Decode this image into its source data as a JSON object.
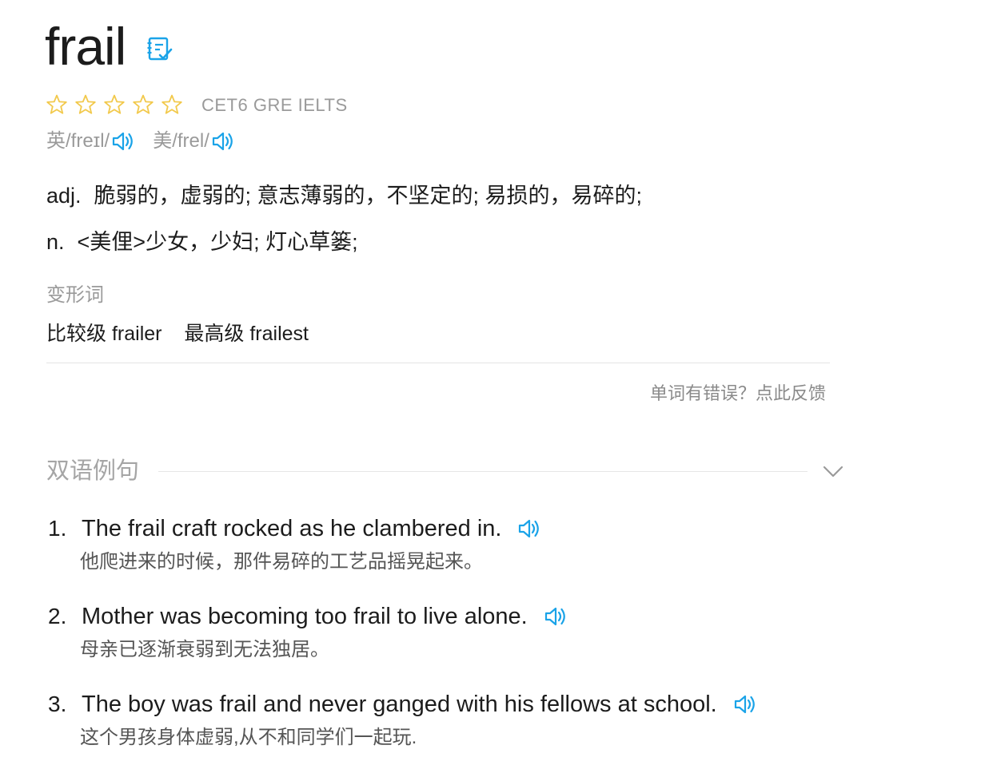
{
  "word": {
    "headword": "frail",
    "wordbook_icon": "wordbook-add-icon",
    "star_count": 5,
    "star_color": "#f2c94c",
    "exams": "CET6 GRE IELTS",
    "phonetics": [
      {
        "label": "英/freɪl/",
        "icon": "speaker-icon"
      },
      {
        "label": "美/frel/",
        "icon": "speaker-icon"
      }
    ],
    "accent_color": "#1aa3e8"
  },
  "definitions": [
    {
      "pos": "adj.",
      "text": "脆弱的，虚弱的; 意志薄弱的，不坚定的; 易损的，易碎的;"
    },
    {
      "pos": "n.",
      "text": "<美俚>少女，少妇; 灯心草篓;"
    }
  ],
  "inflections": {
    "title": "变形词",
    "items": [
      {
        "label": "比较级",
        "value": "frailer"
      },
      {
        "label": "最高级",
        "value": "frailest"
      }
    ]
  },
  "feedback_link": "单词有错误？点此反馈",
  "examples": {
    "title": "双语例句",
    "collapse_icon": "chevron-down-icon",
    "items": [
      {
        "num": "1.",
        "en": "The frail craft rocked as he clambered in.",
        "zh": "他爬进来的时候，那件易碎的工艺品摇晃起来。"
      },
      {
        "num": "2.",
        "en": "Mother was becoming too frail to live alone.",
        "zh": "母亲已逐渐衰弱到无法独居。"
      },
      {
        "num": "3.",
        "en": "The boy was frail and never ganged with his fellows at school.",
        "zh": "这个男孩身体虚弱,从不和同学们一起玩."
      }
    ]
  }
}
